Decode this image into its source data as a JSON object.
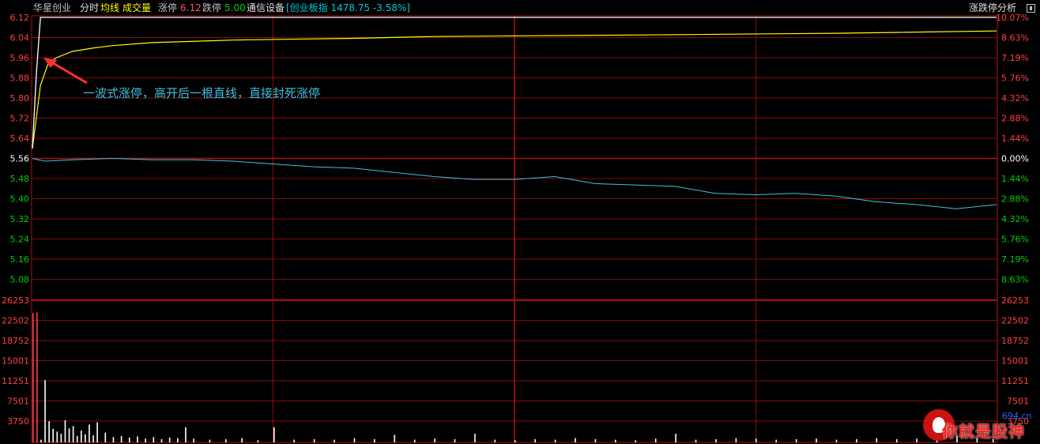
{
  "header": {
    "stock_name": "华星创业",
    "tab_intraday": "分时",
    "tab_avg": "均线",
    "tab_volume": "成交量",
    "limit_up_label": "涨停",
    "limit_up_value": "6.12",
    "limit_down_label": "跌停",
    "limit_down_value": "5.00",
    "industry": "通信设备",
    "index_info": "[创业板指 1478.75 -3.58%]",
    "analysis_button": "涨跌停分析"
  },
  "annotation": "一波式涨停，高开后一根直线，直接封死涨停",
  "watermark": {
    "text": "你就是股神",
    "site": "694.cn"
  },
  "colors": {
    "background": "#000000",
    "grid": "#b01010",
    "price_line": "#ffffff",
    "avg_line": "#ffff00",
    "index_line": "#40c0e0",
    "volume_bar": "#ffffff",
    "volume_bar_early": "#ff4040",
    "up": "#ff4040",
    "down": "#00d000",
    "flat": "#ffffff",
    "arrow": "#ff3030",
    "annotation_text": "#40c0e0"
  },
  "chart_data": {
    "type": "line",
    "price_axis": {
      "ticks": [
        "6.12",
        "6.04",
        "5.96",
        "5.88",
        "5.80",
        "5.72",
        "5.64",
        "5.56",
        "5.48",
        "5.40",
        "5.32",
        "5.24",
        "5.16",
        "5.08"
      ],
      "ylim": [
        5.04,
        6.12
      ],
      "base": 5.56
    },
    "percent_axis": {
      "ticks": [
        "10.07%",
        "8.63%",
        "7.19%",
        "5.76%",
        "4.32%",
        "2.88%",
        "1.44%",
        "0.00%",
        "1.44%",
        "2.88%",
        "4.32%",
        "5.76%",
        "7.19%",
        "8.63%"
      ]
    },
    "volume_axis": {
      "ticks": [
        "26253",
        "22502",
        "18752",
        "15001",
        "11251",
        "7501",
        "3750"
      ],
      "ylim": [
        0,
        26253
      ]
    },
    "series": [
      {
        "key": "price",
        "x": [
          0,
          1,
          2,
          3,
          4,
          5,
          6,
          240
        ],
        "values": [
          5.6,
          5.9,
          6.12,
          6.12,
          6.12,
          6.12,
          6.12,
          6.12
        ]
      },
      {
        "key": "avg",
        "x": [
          0,
          2,
          4,
          6,
          10,
          15,
          20,
          30,
          50,
          80,
          100,
          150,
          200,
          240
        ],
        "values": [
          5.6,
          5.85,
          5.94,
          5.96,
          5.985,
          5.998,
          6.008,
          6.02,
          6.03,
          6.037,
          6.044,
          6.05,
          6.057,
          6.066
        ]
      },
      {
        "key": "index",
        "x": [
          0,
          3,
          10,
          20,
          30,
          40,
          50,
          60,
          70,
          80,
          90,
          100,
          110,
          120,
          130,
          140,
          150,
          160,
          170,
          180,
          190,
          200,
          210,
          220,
          230,
          240
        ],
        "values": [
          0.0,
          -0.2,
          -0.1,
          0.0,
          -0.1,
          -0.1,
          -0.2,
          -0.4,
          -0.6,
          -0.7,
          -1.0,
          -1.3,
          -1.5,
          -1.5,
          -1.3,
          -1.8,
          -1.9,
          -2.0,
          -2.5,
          -2.6,
          -2.5,
          -2.7,
          -3.1,
          -3.3,
          -3.6,
          -3.3
        ]
      }
    ],
    "volume": {
      "x": [
        0,
        1,
        2,
        3,
        4,
        5,
        6,
        7,
        8,
        9,
        10,
        11,
        12,
        13,
        14,
        15,
        16,
        18,
        20,
        22,
        24,
        26,
        28,
        30,
        32,
        34,
        36,
        38,
        40,
        44,
        48,
        52,
        56,
        60,
        65,
        70,
        75,
        80,
        85,
        90,
        95,
        100,
        105,
        110,
        115,
        120,
        125,
        130,
        135,
        140,
        145,
        150,
        155,
        160,
        165,
        170,
        175,
        180,
        185,
        190,
        195,
        200,
        205,
        210,
        215,
        220,
        225,
        230,
        235,
        239
      ],
      "values": [
        23900,
        24000,
        500,
        11500,
        3900,
        2500,
        2000,
        1600,
        4100,
        2600,
        3000,
        1200,
        2200,
        1500,
        3300,
        1300,
        3700,
        1800,
        1000,
        1200,
        900,
        1100,
        700,
        1000,
        600,
        900,
        800,
        2800,
        700,
        500,
        600,
        800,
        400,
        2800,
        500,
        600,
        500,
        800,
        600,
        1400,
        500,
        700,
        600,
        1600,
        500,
        400,
        600,
        500,
        800,
        600,
        500,
        400,
        700,
        1600,
        500,
        600,
        800,
        700,
        500,
        600,
        700,
        500,
        600,
        800,
        600,
        700,
        500,
        1200,
        900,
        600
      ]
    }
  }
}
